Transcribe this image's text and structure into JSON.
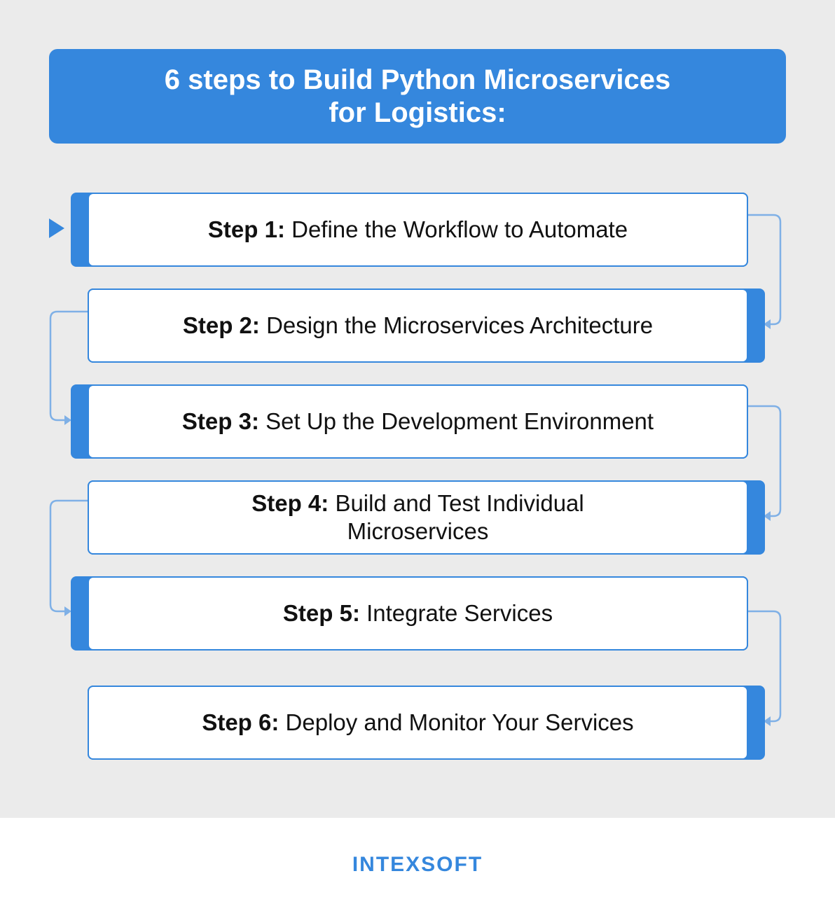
{
  "title": {
    "line1": "6 steps to Build Python Microservices",
    "line2": "for Logistics:"
  },
  "steps": [
    {
      "prefix": "Step 1:",
      "text": "Define the Workflow to Automate"
    },
    {
      "prefix": "Step 2:",
      "text": "Design the Microservices Architecture"
    },
    {
      "prefix": "Step 3:",
      "text": "Set Up the Development Environment"
    },
    {
      "prefix": "Step 4:",
      "text": "Build and Test Individual Microservices"
    },
    {
      "prefix": "Step 5:",
      "text": "Integrate Services"
    },
    {
      "prefix": "Step 6:",
      "text": "Deploy and Monitor Your Services"
    }
  ],
  "logo": "INTEXSOFT",
  "colors": {
    "accent": "#3587dd",
    "background": "#ebebeb",
    "connector": "#7fb0e6"
  }
}
